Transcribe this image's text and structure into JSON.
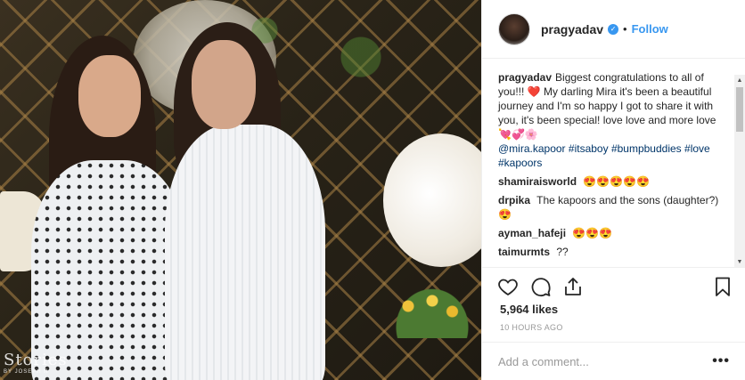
{
  "photo": {
    "watermark_main": "Stories",
    "watermark_sub": "BY JOSEPH R"
  },
  "header": {
    "username": "pragyadav",
    "separator": "•",
    "follow_label": "Follow"
  },
  "caption": {
    "author": "pragyadav",
    "text_1": "Biggest congratulations to all of you!!! ",
    "heart_1": "❤️",
    "text_2": " My darling Mira it's been a beautiful journey and I'm so happy I got to share it with you, it's been special! love love and more love ",
    "emoji_2": "💘💞🌸",
    "mention": "@mira.kapoor",
    "tag_1": "#itsaboy",
    "tag_2": "#bumpbuddies",
    "tag_3": "#love",
    "tag_4": "#kapoors"
  },
  "comments": [
    {
      "author": "shamiraisworld",
      "text": "😍😍😍😍😍"
    },
    {
      "author": "drpika",
      "text": "The kapoors and the sons (daughter?)😍"
    },
    {
      "author": "ayman_hafeji",
      "text": "😍😍😍"
    },
    {
      "author": "taimurmts",
      "text": "??"
    }
  ],
  "actions": {
    "like_icon": "heart-outline",
    "comment_icon": "speech-bubble",
    "share_icon": "share-upload",
    "save_icon": "bookmark"
  },
  "likes": "5,964 likes",
  "timestamp": "10 HOURS AGO",
  "add_comment": {
    "placeholder": "Add a comment...",
    "more_label": "•••"
  },
  "colors": {
    "accent": "#3897f0",
    "link": "#003569",
    "heart": "#ed4956"
  }
}
